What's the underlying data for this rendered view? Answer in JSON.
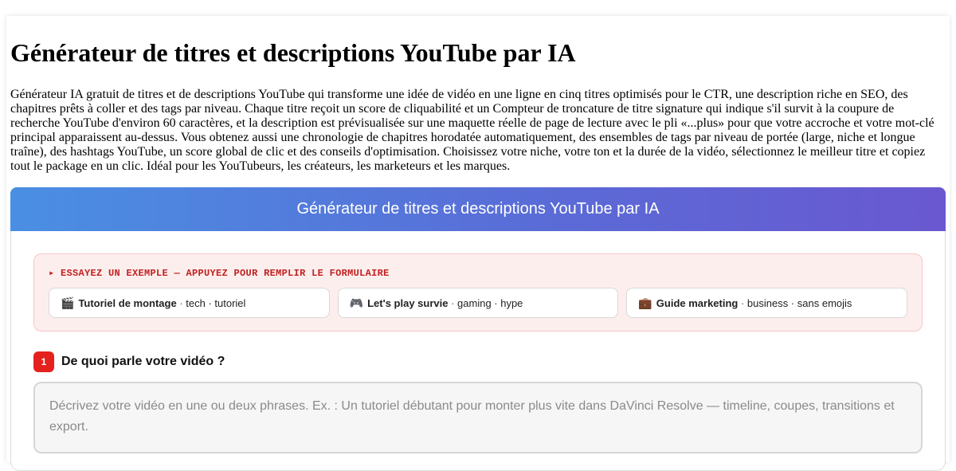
{
  "page": {
    "title": "Générateur de titres et descriptions YouTube par IA",
    "intro": "Générateur IA gratuit de titres et de descriptions YouTube qui transforme une idée de vidéo en une ligne en cinq titres optimisés pour le CTR, une description riche en SEO, des chapitres prêts à coller et des tags par niveau. Chaque titre reçoit un score de cliquabilité et un Compteur de troncature de titre signature qui indique s'il survit à la coupure de recherche YouTube d'environ 60 caractères, et la description est prévisualisée sur une maquette réelle de page de lecture avec le pli «...plus» pour que votre accroche et votre mot-clé principal apparaissent au-dessus. Vous obtenez aussi une chronologie de chapitres horodatée automatiquement, des ensembles de tags par niveau de portée (large, niche et longue traîne), des hashtags YouTube, un score global de clic et des conseils d'optimisation. Choisissez votre niche, votre ton et la durée de la vidéo, sélectionnez le meilleur titre et copiez tout le package en un clic. Idéal pour les YouTubeurs, les créateurs, les marketeurs et les marques."
  },
  "tool": {
    "header": "Générateur de titres et descriptions YouTube par IA",
    "examples_label": "▸ ESSAYEZ UN EXEMPLE — APPUYEZ POUR REMPLIR LE FORMULAIRE",
    "examples": [
      {
        "emoji": "🎬",
        "title": "Tutoriel de montage",
        "tags": "tech · tutoriel"
      },
      {
        "emoji": "🎮",
        "title": "Let's play survie",
        "tags": "gaming · hype"
      },
      {
        "emoji": "💼",
        "title": "Guide marketing",
        "tags": "business · sans emojis"
      }
    ],
    "step1": {
      "number": "1",
      "label": "De quoi parle votre vidéo ?",
      "placeholder": "Décrivez votre vidéo en une ou deux phrases. Ex. : Un tutoriel débutant pour monter plus vite dans DaVinci Resolve — timeline, coupes, transitions et export."
    }
  },
  "colors": {
    "accent_red": "#e5211d",
    "header_gradient_start": "#4a8fe3",
    "header_gradient_end": "#6a58d0",
    "examples_bg": "#fdeeee"
  }
}
